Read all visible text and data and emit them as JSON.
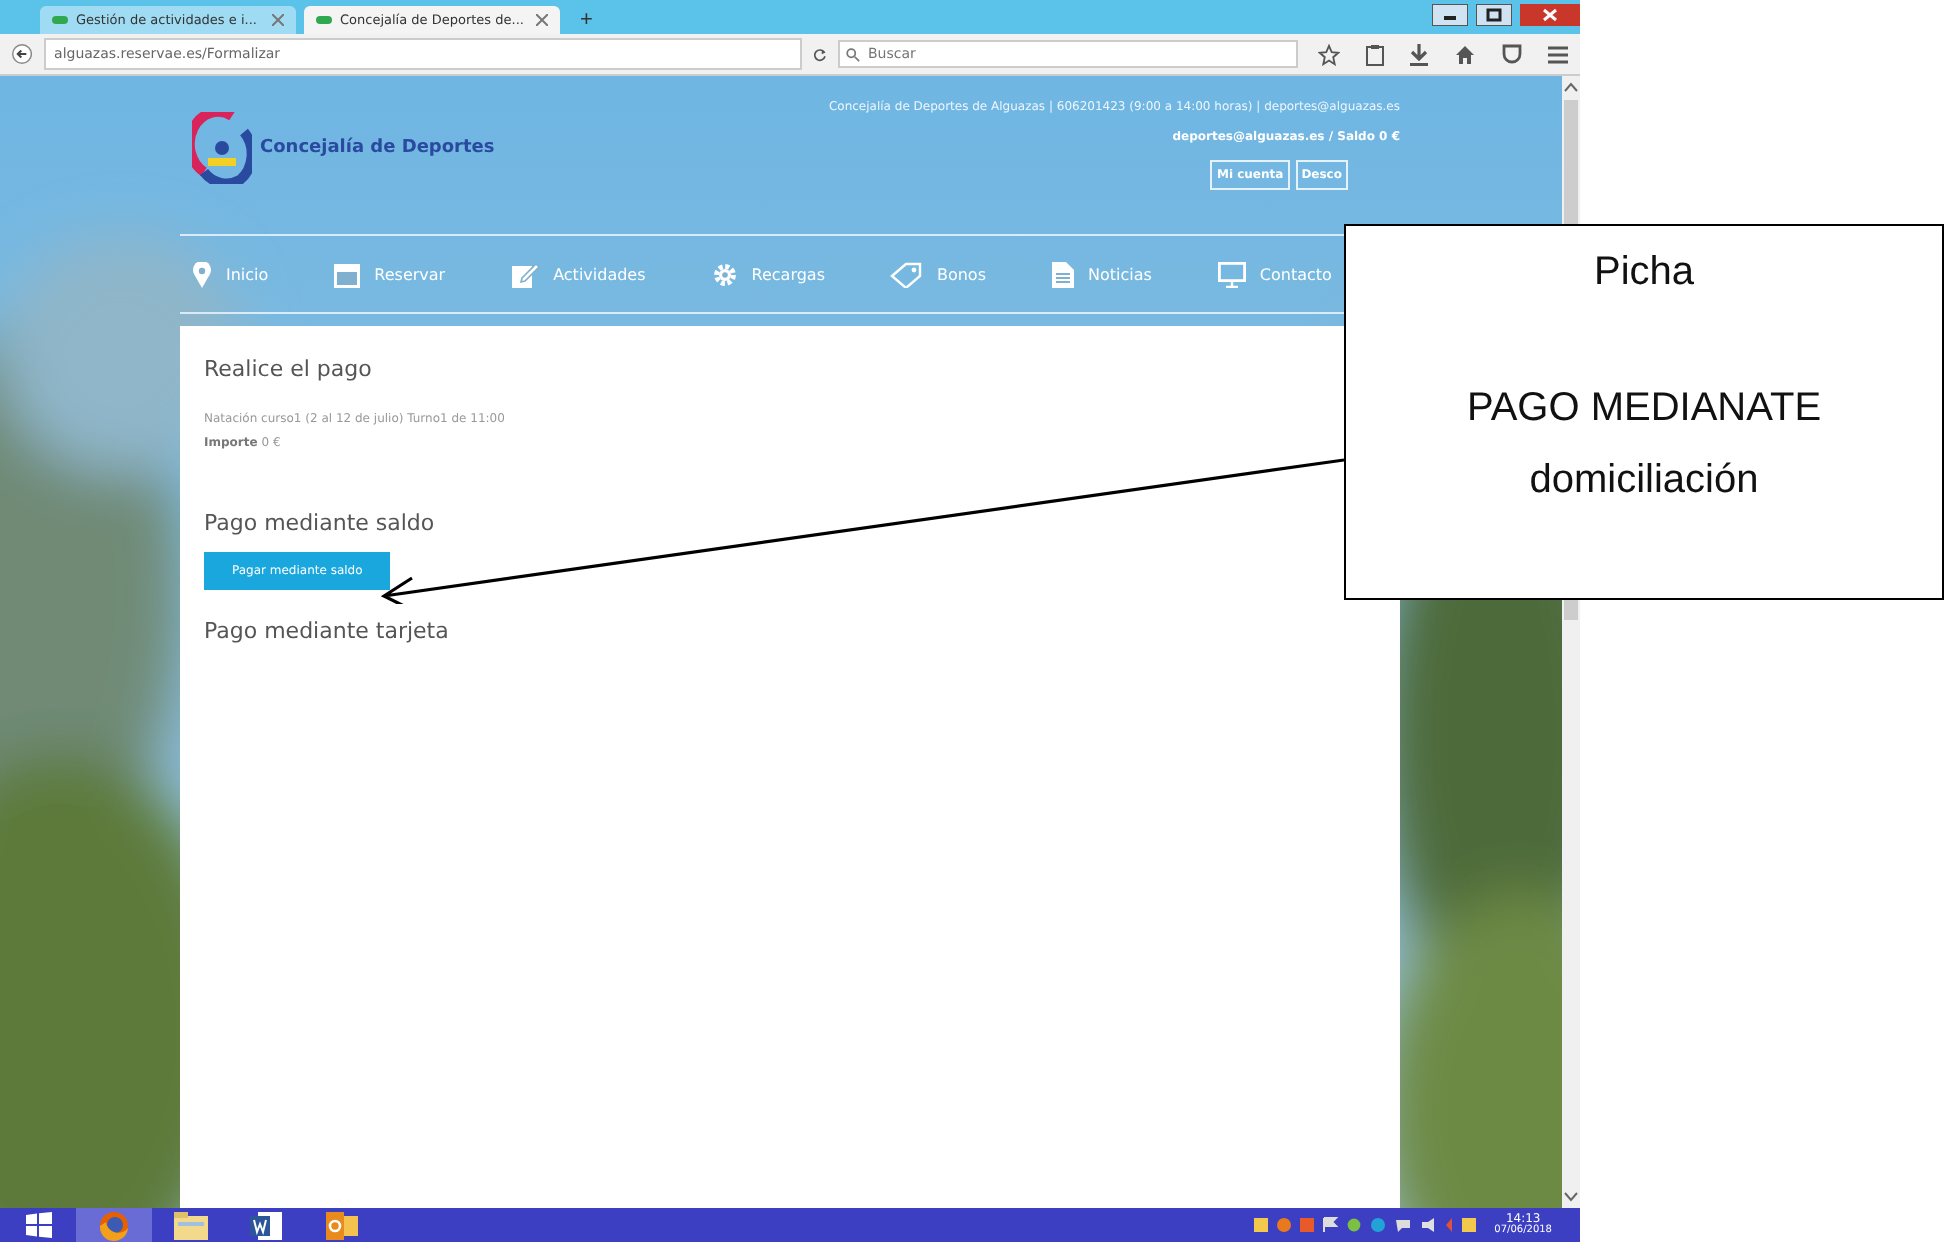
{
  "browser": {
    "tabs": [
      {
        "label": "Gestión de actividades e i...",
        "selected": false
      },
      {
        "label": "Concejalía de Deportes de...",
        "selected": true
      }
    ],
    "new_tab": "+",
    "url": "alguazas.reservae.es/Formalizar",
    "search": {
      "placeholder": "Buscar"
    }
  },
  "site": {
    "logo_text": "Concejalía de Deportes",
    "contact": "Concejalía de Deportes de Alguazas | 606201423 (9:00 a 14:00 horas) | deportes@alguazas.es",
    "account": "deportes@alguazas.es / Saldo 0 €",
    "account_buttons": [
      "Mi cuenta",
      "Desco"
    ],
    "nav": [
      {
        "label": "Inicio"
      },
      {
        "label": "Reservar"
      },
      {
        "label": "Actividades"
      },
      {
        "label": "Recargas"
      },
      {
        "label": "Bonos"
      },
      {
        "label": "Noticias"
      },
      {
        "label": "Contacto"
      }
    ]
  },
  "content": {
    "title": "Realice el pago",
    "description": "Natación curso1 (2 al 12 de julio) Turno1 de 11:00",
    "amount": {
      "label": "Importe",
      "value": "0 €"
    },
    "sections": [
      {
        "heading": "Pago mediante saldo",
        "button": "Pagar mediante saldo"
      },
      {
        "heading": "Pago mediante tarjeta"
      }
    ]
  },
  "taskbar": {
    "apps": [
      {
        "kind": "start"
      },
      {
        "kind": "firefox",
        "selected": true
      },
      {
        "kind": "files",
        "selected": false
      },
      {
        "kind": "word",
        "selected": false
      },
      {
        "kind": "outlook",
        "selected": false
      }
    ],
    "time": "14:13",
    "date": "07/06/2018"
  },
  "callout": {
    "title": "Picha",
    "lines": [
      "PAGO MEDIANATE",
      "domiciliación"
    ]
  }
}
